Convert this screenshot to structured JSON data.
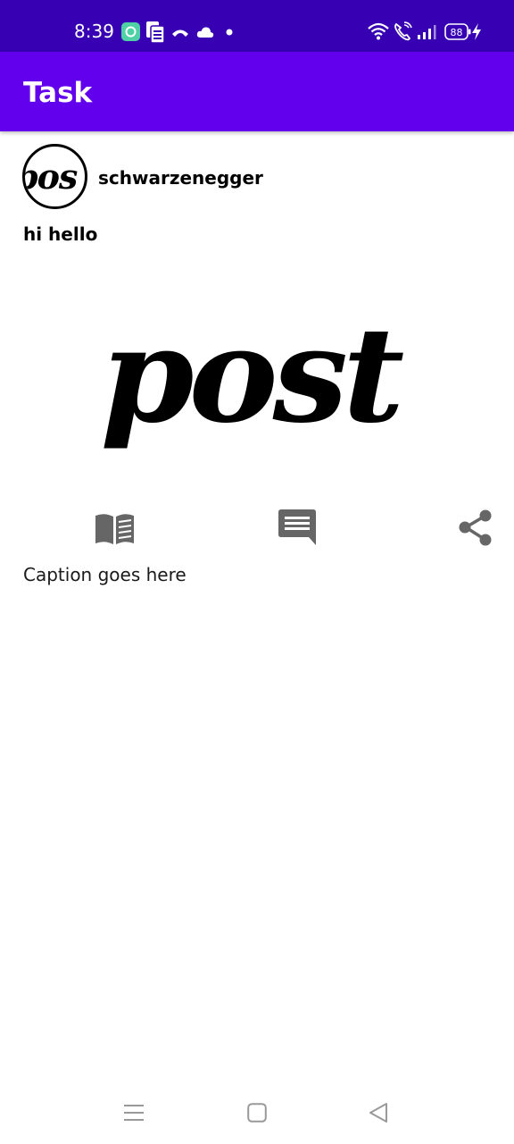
{
  "status_bar": {
    "time": "8:39",
    "battery": "88",
    "icons": [
      "app-notification-icon",
      "document-icon",
      "missed-call-icon",
      "cloud-icon",
      "dot-icon",
      "wifi-icon",
      "wifi-calling-icon",
      "signal-icon",
      "battery-icon",
      "charging-icon"
    ]
  },
  "app_bar": {
    "title": "Task"
  },
  "post": {
    "avatar_text": "pos",
    "username": "schwarzenegger",
    "title": "hi hello",
    "image_text": "post",
    "caption": "Caption goes here",
    "actions": [
      "read-icon",
      "comment-icon",
      "share-icon"
    ]
  },
  "nav_bar": {
    "buttons": [
      "recents-icon",
      "home-icon",
      "back-icon"
    ]
  },
  "colors": {
    "status_bar": "#3700b3",
    "app_bar": "#6200ee",
    "action_icon": "#666666"
  }
}
